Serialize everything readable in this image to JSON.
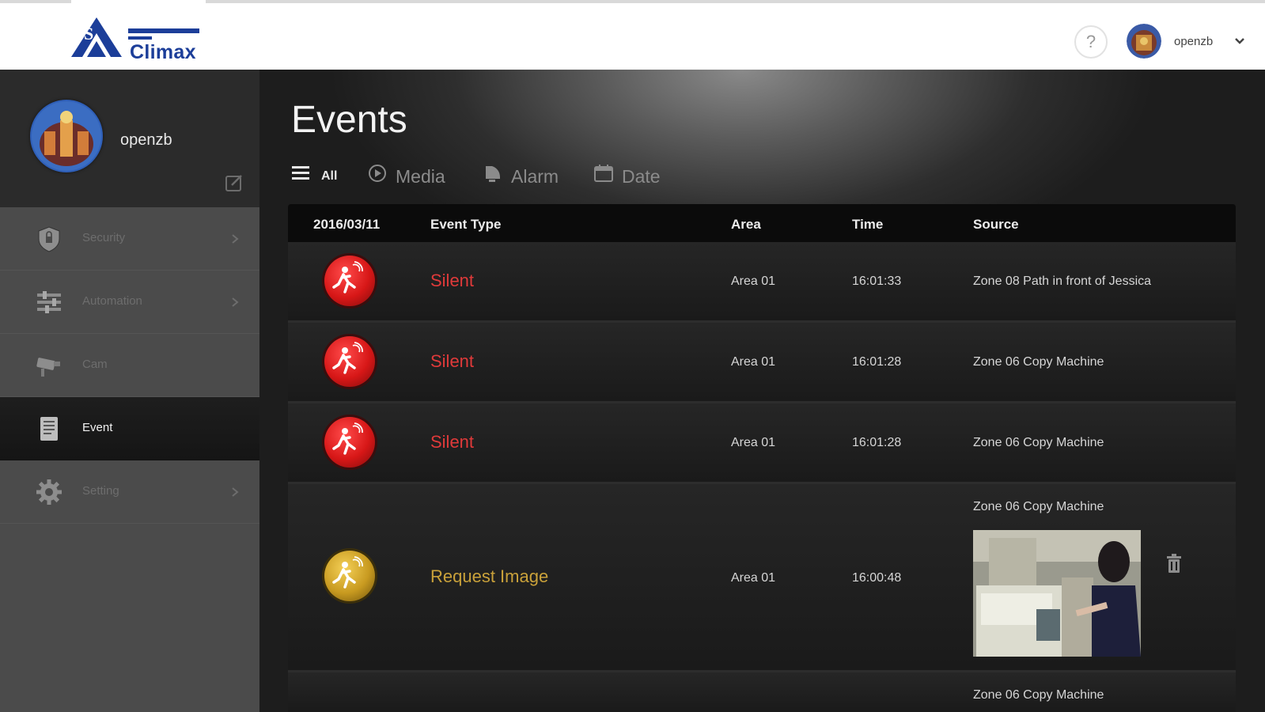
{
  "brand": {
    "logo_text": "Climax",
    "brand_color": "#1c3e99"
  },
  "header": {
    "help_label": "?",
    "user_name": "openzb"
  },
  "sidebar": {
    "profile_name": "openzb",
    "items": [
      {
        "label": "Security",
        "icon": "shield-icon",
        "has_chevron": true
      },
      {
        "label": "Automation",
        "icon": "sliders-icon",
        "has_chevron": true
      },
      {
        "label": "Cam",
        "icon": "camera-icon",
        "has_chevron": false
      },
      {
        "label": "Event",
        "icon": "document-icon",
        "has_chevron": false,
        "active": true
      },
      {
        "label": "Setting",
        "icon": "gear-icon",
        "has_chevron": true
      }
    ]
  },
  "main": {
    "title": "Events",
    "filters": [
      {
        "label": "All",
        "icon": "list-icon",
        "active": true
      },
      {
        "label": "Media",
        "icon": "play-icon"
      },
      {
        "label": "Alarm",
        "icon": "bell-icon"
      },
      {
        "label": "Date",
        "icon": "calendar-icon"
      }
    ],
    "table": {
      "headers": [
        "2016/03/11",
        "Event Type",
        "Area",
        "Time",
        "Source"
      ],
      "rows": [
        {
          "type": "Silent",
          "area": "Area 01",
          "time": "16:01:33",
          "source": "Zone 08 Path in front of Jessica",
          "icon": "silent-alarm-icon",
          "color": "#e03a3a"
        },
        {
          "type": "Silent",
          "area": "Area 01",
          "time": "16:01:28",
          "source": "Zone 06 Copy Machine",
          "icon": "silent-alarm-icon",
          "color": "#e03a3a"
        },
        {
          "type": "Silent",
          "area": "Area 01",
          "time": "16:01:28",
          "source": "Zone 06 Copy Machine",
          "icon": "silent-alarm-icon",
          "color": "#e03a3a"
        },
        {
          "type": "Request Image",
          "area": "Area 01",
          "time": "16:00:48",
          "source": "Zone 06 Copy Machine",
          "icon": "request-image-icon",
          "color": "#c9a13a",
          "has_image": true
        },
        {
          "source": "Zone 06 Copy Machine"
        }
      ]
    }
  }
}
